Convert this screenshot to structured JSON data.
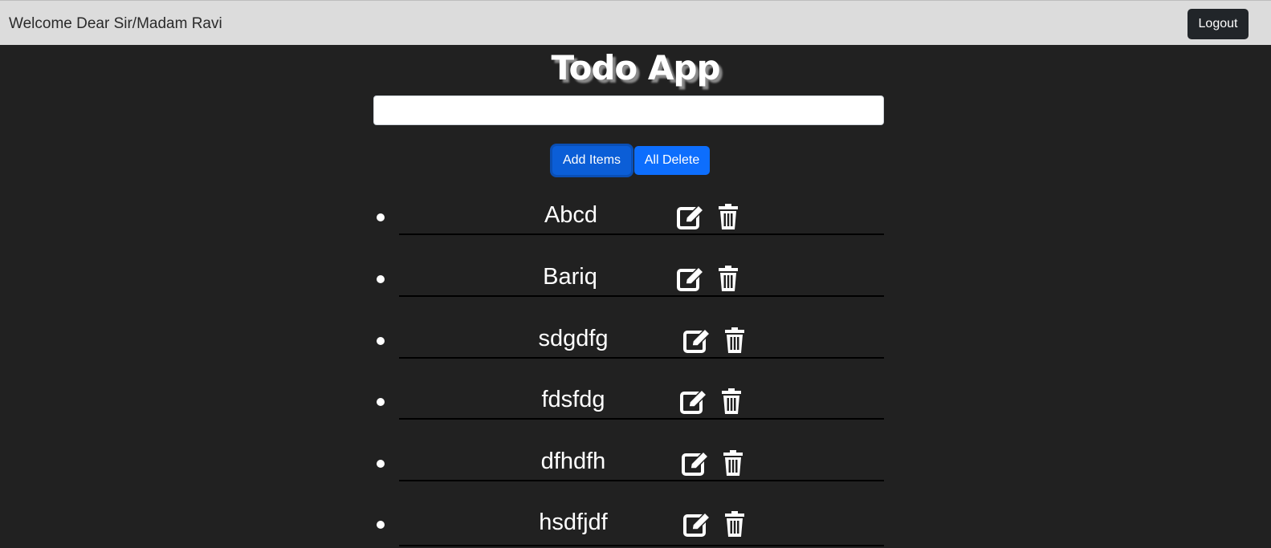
{
  "header": {
    "welcome_text": "Welcome Dear Sir/Madam Ravi",
    "logout_label": "Logout"
  },
  "app": {
    "title": "Todo App",
    "input_value": "",
    "add_label": "Add Items",
    "delete_all_label": "All Delete"
  },
  "todos": [
    {
      "text": "Abcd",
      "edit_icon": "edit-icon",
      "delete_icon": "trash-icon"
    },
    {
      "text": "Bariq",
      "edit_icon": "edit-icon",
      "delete_icon": "trash-icon"
    },
    {
      "text": "sdgdfg",
      "edit_icon": "edit-icon",
      "delete_icon": "trash-icon"
    },
    {
      "text": "fdsfdg",
      "edit_icon": "edit-icon",
      "delete_icon": "trash-icon"
    },
    {
      "text": "dfhdfh",
      "edit_icon": "edit-icon",
      "delete_icon": "trash-icon"
    },
    {
      "text": "hsdfjdf",
      "edit_icon": "edit-icon",
      "delete_icon": "trash-icon"
    }
  ],
  "colors": {
    "background": "#212121",
    "header_bg": "#dcdcdc",
    "primary": "#0d6efd",
    "logout_bg": "#212529"
  }
}
